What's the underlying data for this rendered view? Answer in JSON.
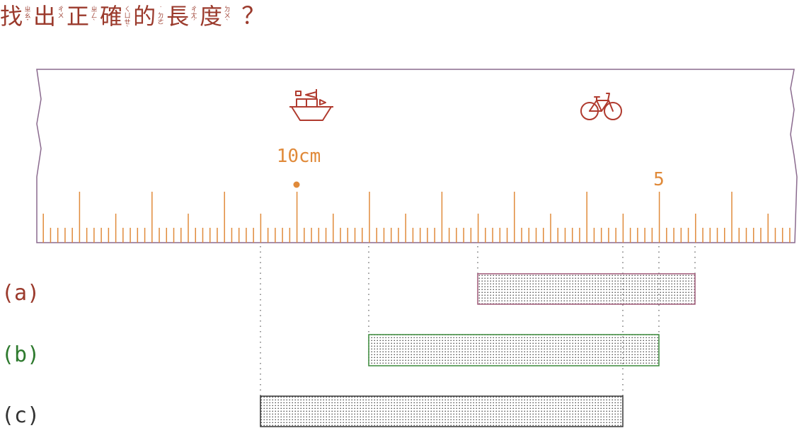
{
  "title": {
    "segments": [
      {
        "char": "找",
        "zhuyin": [
          "ㄓ",
          "ㄠ",
          "ˇ"
        ]
      },
      {
        "char": "出",
        "zhuyin": [
          "ㄔ",
          "ㄨ"
        ]
      },
      {
        "char": "正",
        "zhuyin": [
          "ㄓ",
          "ㄥ",
          "ˋ"
        ]
      },
      {
        "char": "確",
        "zhuyin": [
          "ㄑ",
          "ㄩ",
          "ㄝ",
          "ˋ"
        ]
      },
      {
        "char": "的",
        "zhuyin": [
          "˙",
          "ㄉ",
          "ㄜ"
        ]
      },
      {
        "char": "長",
        "zhuyin": [
          "ㄔ",
          "ㄤ",
          "ˊ"
        ]
      },
      {
        "char": "度",
        "zhuyin": [
          "ㄉ",
          "ㄨ",
          "ˋ"
        ]
      }
    ],
    "question_mark": "？"
  },
  "ruler": {
    "label_10cm": "10cm",
    "label_5": "5",
    "icons": [
      "ship-icon",
      "bicycle-icon"
    ],
    "color_ticks": "#e08a3a",
    "color_border": "#8a6a8e"
  },
  "options": [
    {
      "label": "(a)",
      "color": "#9b3a2c",
      "border": "#a05a78"
    },
    {
      "label": "(b)",
      "color": "#2e7a2e",
      "border": "#3a8a3a"
    },
    {
      "label": "(c)",
      "color": "#333333",
      "border": "#333333"
    }
  ]
}
